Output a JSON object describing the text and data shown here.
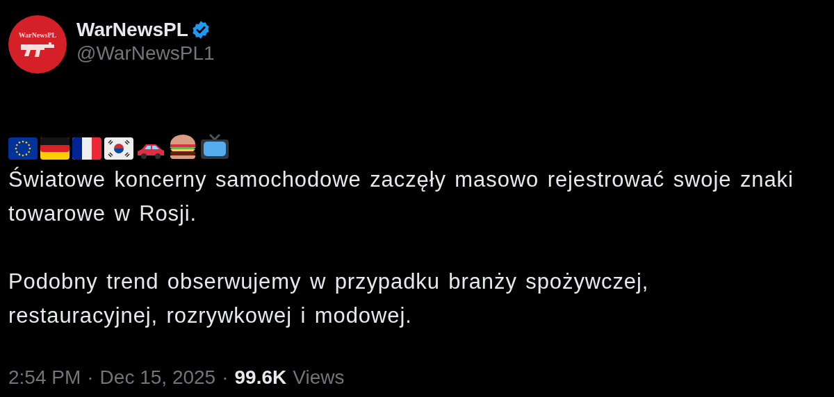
{
  "author": {
    "name": "WarNewsPL",
    "handle": "@WarNewsPL1",
    "verified": true,
    "avatar_text": "WarNewsPL"
  },
  "emoji_row": [
    {
      "kind": "eu-flag"
    },
    {
      "kind": "de-flag"
    },
    {
      "kind": "fr-flag"
    },
    {
      "kind": "kr-flag"
    },
    {
      "kind": "car"
    },
    {
      "kind": "burger"
    },
    {
      "kind": "tv"
    }
  ],
  "paragraphs": [
    "Światowe koncerny samochodowe zaczęły masowo rejestrować swoje znaki towarowe w Rosji.",
    "Podobny trend obserwujemy w przypadku branży spożywczej, restauracyjnej, rozrywkowej i modowej."
  ],
  "meta": {
    "time": "2:54 PM",
    "separator_1": "·",
    "date": "Dec 15, 2025",
    "separator_2": "·",
    "views_count": "99.6K",
    "views_label": "Views"
  }
}
